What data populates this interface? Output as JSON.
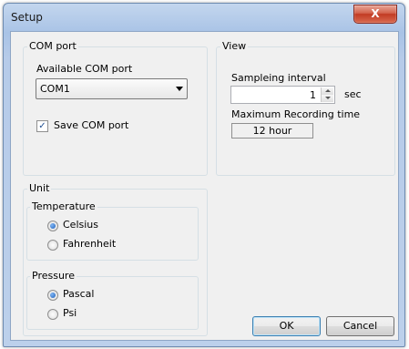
{
  "window": {
    "title": "Setup",
    "close_glyph": "X"
  },
  "com_port": {
    "group_title": "COM port",
    "available_label": "Available COM port",
    "selected": "COM1",
    "save_label": "Save COM port",
    "save_checked": true
  },
  "view": {
    "group_title": "View",
    "interval_label": "Sampleing interval",
    "interval_value": "1",
    "interval_unit": "sec",
    "max_label": "Maximum Recording time",
    "max_value": "12 hour"
  },
  "unit": {
    "group_title": "Unit",
    "temperature": {
      "title": "Temperature",
      "options": [
        "Celsius",
        "Fahrenheit"
      ],
      "selected": "Celsius"
    },
    "pressure": {
      "title": "Pressure",
      "options": [
        "Pascal",
        "Psi"
      ],
      "selected": "Pascal"
    }
  },
  "buttons": {
    "ok": "OK",
    "cancel": "Cancel"
  }
}
